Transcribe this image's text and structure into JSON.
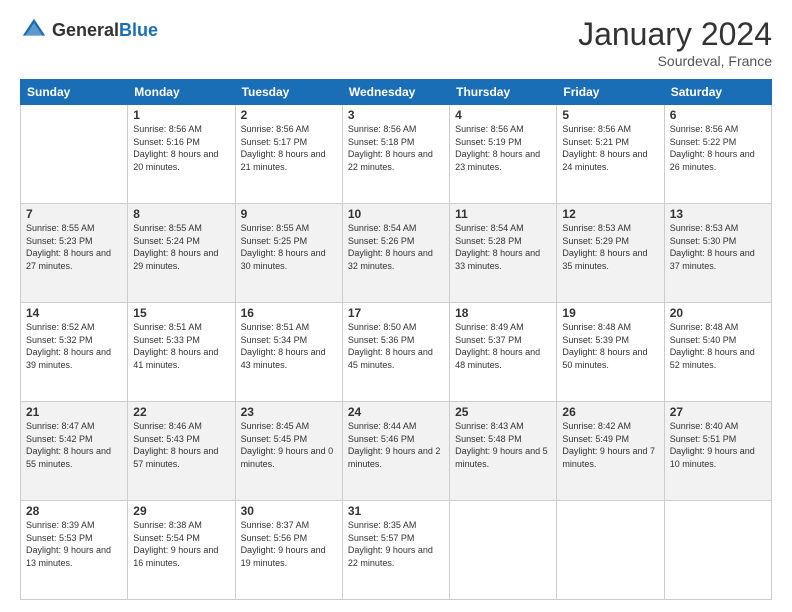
{
  "logo": {
    "text_general": "General",
    "text_blue": "Blue"
  },
  "header": {
    "month": "January 2024",
    "location": "Sourdeval, France"
  },
  "days_of_week": [
    "Sunday",
    "Monday",
    "Tuesday",
    "Wednesday",
    "Thursday",
    "Friday",
    "Saturday"
  ],
  "weeks": [
    [
      {
        "day": "",
        "info": ""
      },
      {
        "day": "1",
        "info": "Sunrise: 8:56 AM\nSunset: 5:16 PM\nDaylight: 8 hours\nand 20 minutes."
      },
      {
        "day": "2",
        "info": "Sunrise: 8:56 AM\nSunset: 5:17 PM\nDaylight: 8 hours\nand 21 minutes."
      },
      {
        "day": "3",
        "info": "Sunrise: 8:56 AM\nSunset: 5:18 PM\nDaylight: 8 hours\nand 22 minutes."
      },
      {
        "day": "4",
        "info": "Sunrise: 8:56 AM\nSunset: 5:19 PM\nDaylight: 8 hours\nand 23 minutes."
      },
      {
        "day": "5",
        "info": "Sunrise: 8:56 AM\nSunset: 5:21 PM\nDaylight: 8 hours\nand 24 minutes."
      },
      {
        "day": "6",
        "info": "Sunrise: 8:56 AM\nSunset: 5:22 PM\nDaylight: 8 hours\nand 26 minutes."
      }
    ],
    [
      {
        "day": "7",
        "info": "Sunrise: 8:55 AM\nSunset: 5:23 PM\nDaylight: 8 hours\nand 27 minutes."
      },
      {
        "day": "8",
        "info": "Sunrise: 8:55 AM\nSunset: 5:24 PM\nDaylight: 8 hours\nand 29 minutes."
      },
      {
        "day": "9",
        "info": "Sunrise: 8:55 AM\nSunset: 5:25 PM\nDaylight: 8 hours\nand 30 minutes."
      },
      {
        "day": "10",
        "info": "Sunrise: 8:54 AM\nSunset: 5:26 PM\nDaylight: 8 hours\nand 32 minutes."
      },
      {
        "day": "11",
        "info": "Sunrise: 8:54 AM\nSunset: 5:28 PM\nDaylight: 8 hours\nand 33 minutes."
      },
      {
        "day": "12",
        "info": "Sunrise: 8:53 AM\nSunset: 5:29 PM\nDaylight: 8 hours\nand 35 minutes."
      },
      {
        "day": "13",
        "info": "Sunrise: 8:53 AM\nSunset: 5:30 PM\nDaylight: 8 hours\nand 37 minutes."
      }
    ],
    [
      {
        "day": "14",
        "info": "Sunrise: 8:52 AM\nSunset: 5:32 PM\nDaylight: 8 hours\nand 39 minutes."
      },
      {
        "day": "15",
        "info": "Sunrise: 8:51 AM\nSunset: 5:33 PM\nDaylight: 8 hours\nand 41 minutes."
      },
      {
        "day": "16",
        "info": "Sunrise: 8:51 AM\nSunset: 5:34 PM\nDaylight: 8 hours\nand 43 minutes."
      },
      {
        "day": "17",
        "info": "Sunrise: 8:50 AM\nSunset: 5:36 PM\nDaylight: 8 hours\nand 45 minutes."
      },
      {
        "day": "18",
        "info": "Sunrise: 8:49 AM\nSunset: 5:37 PM\nDaylight: 8 hours\nand 48 minutes."
      },
      {
        "day": "19",
        "info": "Sunrise: 8:48 AM\nSunset: 5:39 PM\nDaylight: 8 hours\nand 50 minutes."
      },
      {
        "day": "20",
        "info": "Sunrise: 8:48 AM\nSunset: 5:40 PM\nDaylight: 8 hours\nand 52 minutes."
      }
    ],
    [
      {
        "day": "21",
        "info": "Sunrise: 8:47 AM\nSunset: 5:42 PM\nDaylight: 8 hours\nand 55 minutes."
      },
      {
        "day": "22",
        "info": "Sunrise: 8:46 AM\nSunset: 5:43 PM\nDaylight: 8 hours\nand 57 minutes."
      },
      {
        "day": "23",
        "info": "Sunrise: 8:45 AM\nSunset: 5:45 PM\nDaylight: 9 hours\nand 0 minutes."
      },
      {
        "day": "24",
        "info": "Sunrise: 8:44 AM\nSunset: 5:46 PM\nDaylight: 9 hours\nand 2 minutes."
      },
      {
        "day": "25",
        "info": "Sunrise: 8:43 AM\nSunset: 5:48 PM\nDaylight: 9 hours\nand 5 minutes."
      },
      {
        "day": "26",
        "info": "Sunrise: 8:42 AM\nSunset: 5:49 PM\nDaylight: 9 hours\nand 7 minutes."
      },
      {
        "day": "27",
        "info": "Sunrise: 8:40 AM\nSunset: 5:51 PM\nDaylight: 9 hours\nand 10 minutes."
      }
    ],
    [
      {
        "day": "28",
        "info": "Sunrise: 8:39 AM\nSunset: 5:53 PM\nDaylight: 9 hours\nand 13 minutes."
      },
      {
        "day": "29",
        "info": "Sunrise: 8:38 AM\nSunset: 5:54 PM\nDaylight: 9 hours\nand 16 minutes."
      },
      {
        "day": "30",
        "info": "Sunrise: 8:37 AM\nSunset: 5:56 PM\nDaylight: 9 hours\nand 19 minutes."
      },
      {
        "day": "31",
        "info": "Sunrise: 8:35 AM\nSunset: 5:57 PM\nDaylight: 9 hours\nand 22 minutes."
      },
      {
        "day": "",
        "info": ""
      },
      {
        "day": "",
        "info": ""
      },
      {
        "day": "",
        "info": ""
      }
    ]
  ]
}
